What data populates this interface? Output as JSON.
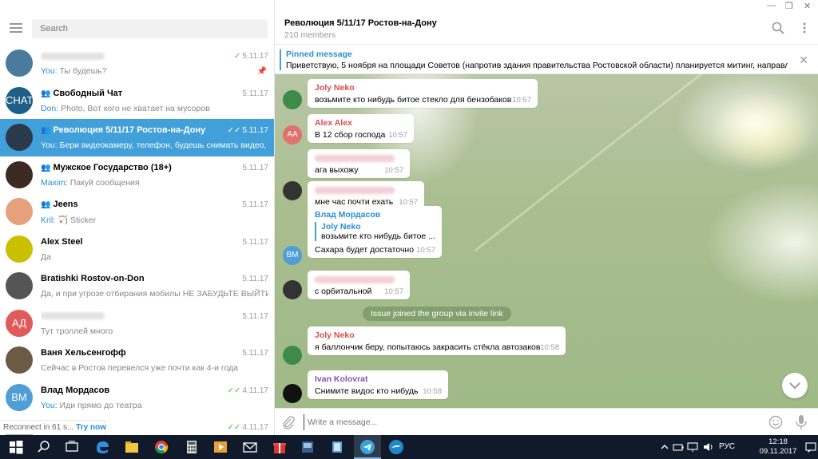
{
  "window": {
    "minimize": "—",
    "maximize": "❐",
    "close": "✕"
  },
  "search": {
    "placeholder": "Search"
  },
  "chats": [
    {
      "name": "",
      "preview_who": "You:",
      "preview": " Ты будешь?",
      "date": "5.11.17",
      "ticks": "✓",
      "pinned": true,
      "avatar_color": "#4a7a9c",
      "group": false
    },
    {
      "name": "Свободный Чат",
      "preview_who": "Don:",
      "preview": " Photo, Вот кого не хватает на мусоров",
      "date": "5.11.17",
      "ticks": "",
      "avatar_color": "#1f5e86",
      "avatar_text": "CHAT",
      "group": true
    },
    {
      "name": "Революция 5/11/17 Ростов-на-Дону",
      "preview_who": "You:",
      "preview": " Бери видеокамеру, телефон, будешь снимать видео, е...",
      "date": "5.11.17",
      "ticks": "✓✓",
      "avatar_color": "#2b3a4a",
      "group": true,
      "active": true
    },
    {
      "name": "Мужское Государство (18+)",
      "preview_who": "Maxim:",
      "preview": " Пакуй сообщения",
      "date": "5.11.17",
      "ticks": "",
      "avatar_color": "#3b2a22",
      "group": true
    },
    {
      "name": "Jeens",
      "preview_who": "Kril:",
      "preview": " 🏹 Sticker",
      "date": "5.11.17",
      "ticks": "",
      "avatar_color": "#e6a07d",
      "group": true
    },
    {
      "name": "Alex Steel",
      "preview_who": "",
      "preview": "Да",
      "date": "5.11.17",
      "ticks": "",
      "avatar_color": "#c9c000",
      "group": false
    },
    {
      "name": "Bratishki Rostov-on-Don",
      "preview_who": "",
      "preview": "Да, и при угрозе отбирания мобилы НЕ ЗАБУДЬТЕ ВЫЙТИ ...",
      "date": "5.11.17",
      "ticks": "",
      "avatar_color": "#555",
      "group": false
    },
    {
      "name": "",
      "preview_who": "",
      "preview": "Тут троллей много",
      "date": "5.11.17",
      "ticks": "",
      "avatar_color": "#e05a5a",
      "avatar_text": "АД",
      "group": false
    },
    {
      "name": "Ваня Хельсенгофф",
      "preview_who": "",
      "preview": "Сейчас в Ростов перевелся уже почти как 4-и года",
      "date": "5.11.17",
      "ticks": "",
      "avatar_color": "#6b5a44",
      "group": false
    },
    {
      "name": "Влад Мордасов",
      "preview_who": "You:",
      "preview": " Иди прямо до театра",
      "date": "4.11.17",
      "ticks": "✓✓",
      "avatar_color": "#4f9ed8",
      "avatar_text": "ВМ",
      "group": false
    },
    {
      "name": "",
      "preview_who": "",
      "preview": "",
      "date": "4.11.17",
      "ticks": "✓✓",
      "avatar_color": "#aaa",
      "group": false
    }
  ],
  "reconnect": {
    "text": "Reconnect in 61 s...",
    "action": "Try now"
  },
  "header": {
    "title": "Революция 5/11/17 Ростов-на-Дону",
    "members": "210 members"
  },
  "pinned": {
    "label": "Pinned message",
    "text": "Приветствую, 5 ноября на площади Советов (напротив здания правительства Ростовской области) планируется митинг, направле..."
  },
  "messages": [
    {
      "sender": "Joly Neko",
      "sender_color": "#d64f4f",
      "text": "возьмите кто нибудь битое стекло для бензобаков",
      "time": "10:57",
      "avatar_color": "#3d8a4a"
    },
    {
      "sender": "Alex Alex",
      "sender_color": "#d64f4f",
      "text": "В 12 сбор господа",
      "time": "10:57",
      "avatar_color": "#e0716f",
      "avatar_text": "AA"
    },
    {
      "sender": "",
      "text": "ага выхожу",
      "time": "10:57"
    },
    {
      "sender": "",
      "text": "мне час почти ехать",
      "time": "10:57",
      "avatar_color": "#333"
    },
    {
      "sender": "Влад Мордасов",
      "sender_color": "#2a8fd4",
      "reply_name": "Joly Neko",
      "reply_text": "возьмите кто нибудь битое ...",
      "text": "Сахара будет достаточно",
      "time": "10:57",
      "avatar_color": "#4f9ed8",
      "avatar_text": "ВМ"
    },
    {
      "sender": "",
      "text": "с орбитальной",
      "time": "10:57",
      "avatar_color": "#333"
    },
    {
      "sender": "Joly Neko",
      "sender_color": "#d64f4f",
      "text": "я баллончик беру, попытаюсь закрасить стёкла автозаков",
      "time": "10:58",
      "avatar_color": "#3d8a4a"
    },
    {
      "sender": "Ivan Kolovrat",
      "sender_color": "#8a4fc0",
      "text": "Снимите видос кто нибудь",
      "time": "10:58",
      "avatar_color": "#111"
    }
  ],
  "service": "Issue joined the group via invite link",
  "composer": {
    "placeholder": "Write a message..."
  },
  "tray": {
    "lang": "РУС",
    "time": "12:18",
    "date": "09.11.2017"
  }
}
